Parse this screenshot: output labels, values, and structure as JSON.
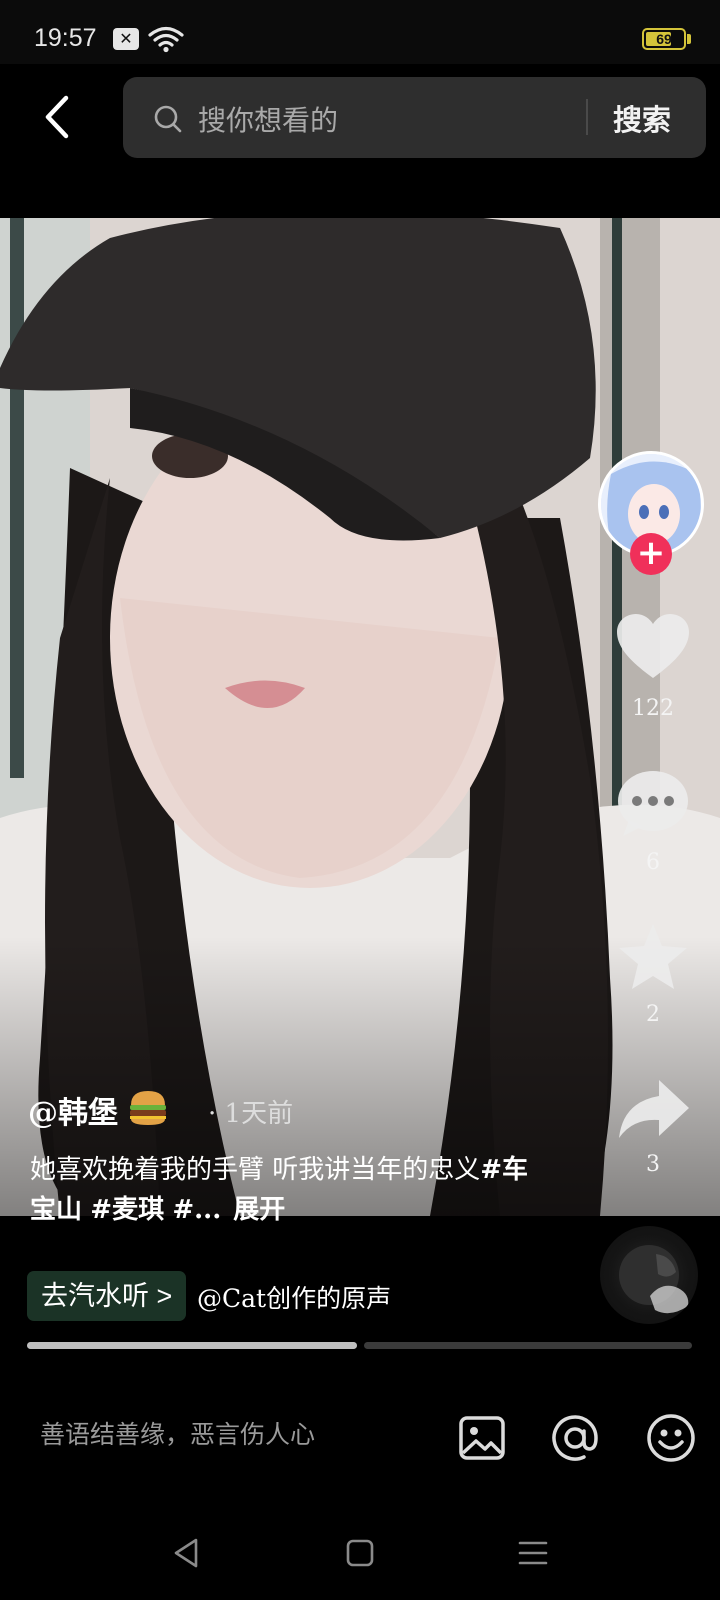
{
  "status_bar": {
    "time": "19:57",
    "battery_text": "69",
    "battery_level_percent": 69,
    "icons": [
      "notification-icon",
      "wifi-icon",
      "battery-icon"
    ]
  },
  "search": {
    "placeholder": "搜你想看的",
    "button_label": "搜索"
  },
  "rail": {
    "like_count": "122",
    "comment_count": "6",
    "favorite_count": "2",
    "share_count": "3",
    "follow_symbol": "+"
  },
  "post": {
    "author": "@韩堡",
    "time": "· 1天前",
    "caption_text": "她喜欢挽着我的手臂 听我讲当年的忠义",
    "tags": [
      "#车宝山",
      "#麦琪",
      "#..."
    ],
    "expand_label": "展开"
  },
  "music": {
    "button_label": "去汽水听 >",
    "source": "@Cat创作的原声"
  },
  "progress": {
    "segments": 2,
    "current_segment_fill": 1.0
  },
  "comment_bar": {
    "placeholder": "善语结善缘，恶言伤人心"
  },
  "colors": {
    "accent_red": "#f0305a",
    "battery_yellow": "#d4c43a",
    "music_green": "#1b3326"
  }
}
